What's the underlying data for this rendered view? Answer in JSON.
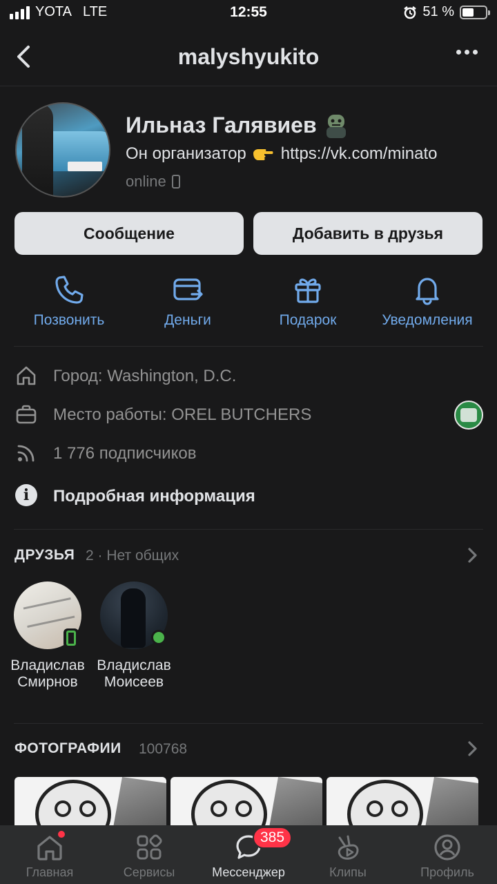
{
  "status_bar": {
    "carrier": "YOTA",
    "network": "LTE",
    "time": "12:55",
    "battery_percent": "51 %",
    "battery_level": 0.51
  },
  "header": {
    "title": "malyshyukito"
  },
  "profile": {
    "name": "Ильназ Галявиев",
    "status": "Он организатор",
    "status_link": "https://vk.com/minato",
    "online": "online"
  },
  "buttons": {
    "message": "Сообщение",
    "add_friend": "Добавить в друзья"
  },
  "actions": [
    {
      "label": "Позвонить",
      "icon": "phone-icon"
    },
    {
      "label": "Деньги",
      "icon": "money-transfer-icon"
    },
    {
      "label": "Подарок",
      "icon": "gift-icon"
    },
    {
      "label": "Уведомления",
      "icon": "bell-icon"
    }
  ],
  "info": {
    "city": "Город: Washington, D.C.",
    "work": "Место работы: OREL BUTCHERS",
    "followers": "1 776 подписчиков",
    "details": "Подробная информация"
  },
  "friends": {
    "title": "ДРУЗЬЯ",
    "subtitle": "2 · Нет общих",
    "items": [
      {
        "first": "Владислав",
        "last": "Смирнов",
        "presence": "mobile"
      },
      {
        "first": "Владислав",
        "last": "Моисеев",
        "presence": "online"
      }
    ]
  },
  "photos": {
    "title": "ФОТОГРАФИИ",
    "count": "100768"
  },
  "tabbar": {
    "tabs": [
      {
        "label": "Главная",
        "icon": "home-icon"
      },
      {
        "label": "Сервисы",
        "icon": "services-icon"
      },
      {
        "label": "Мессенджер",
        "icon": "messenger-icon",
        "badge": "385"
      },
      {
        "label": "Клипы",
        "icon": "clips-icon"
      },
      {
        "label": "Профиль",
        "icon": "profile-icon"
      }
    ]
  },
  "colors": {
    "background": "#19191a",
    "accent": "#71aaeb",
    "badge": "#ff3347",
    "online": "#4bb34b"
  }
}
